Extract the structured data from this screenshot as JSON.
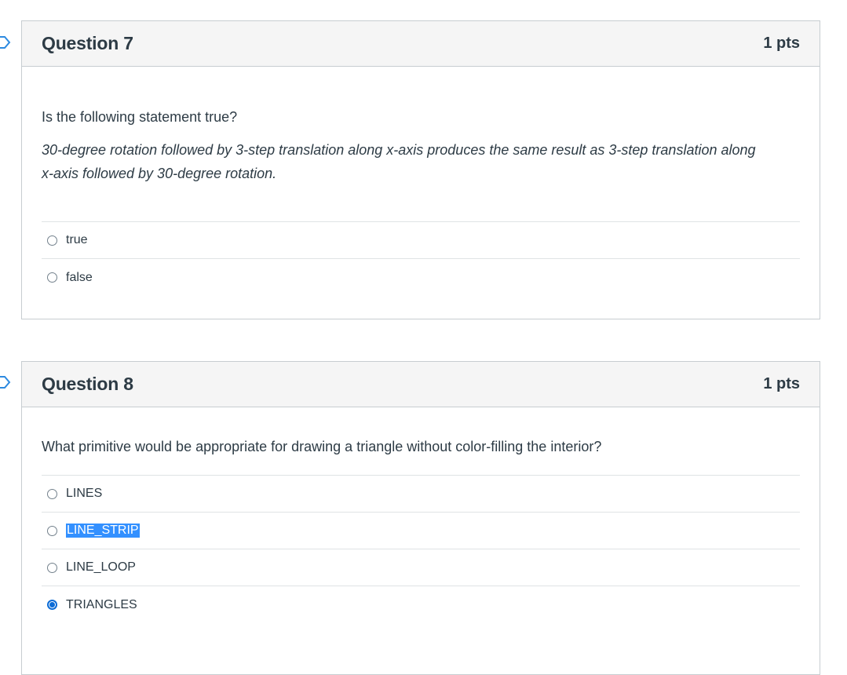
{
  "questions": [
    {
      "title": "Question 7",
      "points": "1 pts",
      "prompt": "Is the following statement true?",
      "statement_line1": "30-degree rotation followed by 3-step translation along x-axis produces the same result as 3-step translation along",
      "statement_line2": "x-axis followed by 30-degree rotation.",
      "answers": [
        {
          "label": "true",
          "checked": false
        },
        {
          "label": "false",
          "checked": false
        }
      ]
    },
    {
      "title": "Question 8",
      "points": "1 pts",
      "prompt": "What primitive would be appropriate for drawing a triangle without color-filling the interior?",
      "answers": [
        {
          "label": "LINES",
          "checked": false
        },
        {
          "label": "LINE_STRIP",
          "checked": false,
          "text_selected": true
        },
        {
          "label": "LINE_LOOP",
          "checked": false
        },
        {
          "label": "TRIANGLES",
          "checked": true
        }
      ]
    }
  ],
  "colors": {
    "accent": "#0b6bd6",
    "selection": "#3390ff",
    "text": "#2d3b45",
    "header_bg": "#f5f5f5",
    "border": "#c7cdd1"
  }
}
